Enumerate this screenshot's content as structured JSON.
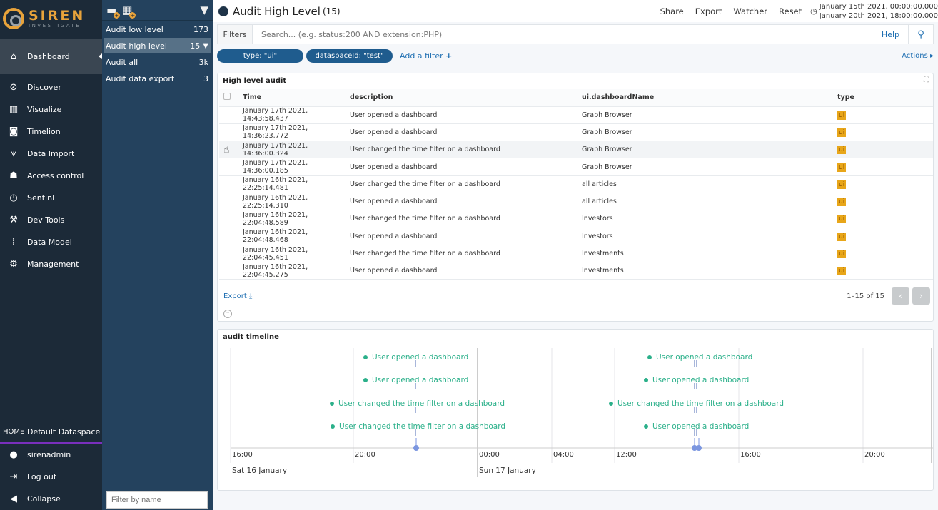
{
  "nav": {
    "logo_title": "SIREN",
    "logo_sub": "INVESTIGATE",
    "items": [
      {
        "label": "Dashboard",
        "icon": "home-icon",
        "active": true
      },
      {
        "label": "Discover",
        "icon": "compass-icon"
      },
      {
        "label": "Visualize",
        "icon": "bar-chart-icon"
      },
      {
        "label": "Timelion",
        "icon": "timelion-icon"
      },
      {
        "label": "Data Import",
        "icon": "data-import-icon"
      },
      {
        "label": "Access control",
        "icon": "users-icon"
      },
      {
        "label": "Sentinl",
        "icon": "alarm-icon"
      },
      {
        "label": "Dev Tools",
        "icon": "wrench-icon"
      },
      {
        "label": "Data Model",
        "icon": "data-model-icon"
      },
      {
        "label": "Management",
        "icon": "gear-icon"
      }
    ],
    "home_label": "HOME",
    "dataspace": "Default Dataspace",
    "user": "sirenadmin",
    "logout": "Log out",
    "collapse": "Collapse"
  },
  "dashboards": {
    "items": [
      {
        "label": "Audit low level",
        "count": "173"
      },
      {
        "label": "Audit high level",
        "count": "15",
        "selected": true
      },
      {
        "label": "Audit all",
        "count": "3k"
      },
      {
        "label": "Audit data export",
        "count": "3"
      }
    ],
    "filter_placeholder": "Filter by name"
  },
  "header": {
    "title": "Audit High Level",
    "count": "(15)",
    "menu": [
      "Share",
      "Export",
      "Watcher",
      "Reset"
    ],
    "time_from": "January 15th 2021, 00:00:00.000",
    "time_to": "January 20th 2021, 18:00:00.000"
  },
  "search": {
    "filters_label": "Filters",
    "placeholder": "Search... (e.g. status:200 AND extension:PHP)",
    "help": "Help"
  },
  "filters": {
    "pills": [
      "type: \"ui\"",
      "dataspaceId: \"test\""
    ],
    "add_filter": "Add a filter",
    "actions": "Actions"
  },
  "table_panel": {
    "title": "High level audit",
    "columns": [
      "Time",
      "description",
      "ui.dashboardName",
      "type"
    ],
    "rows": [
      {
        "time": "January 17th 2021, 14:43:58.437",
        "description": "User opened a dashboard",
        "dashboard": "Graph Browser",
        "type": "ui"
      },
      {
        "time": "January 17th 2021, 14:36:23.772",
        "description": "User opened a dashboard",
        "dashboard": "Graph Browser",
        "type": "ui"
      },
      {
        "time": "January 17th 2021, 14:36:00.324",
        "description": "User changed the time filter on a dashboard",
        "dashboard": "Graph Browser",
        "type": "ui"
      },
      {
        "time": "January 17th 2021, 14:36:00.185",
        "description": "User opened a dashboard",
        "dashboard": "Graph Browser",
        "type": "ui"
      },
      {
        "time": "January 16th 2021, 22:25:14.481",
        "description": "User changed the time filter on a dashboard",
        "dashboard": "all articles",
        "type": "ui"
      },
      {
        "time": "January 16th 2021, 22:25:14.310",
        "description": "User opened a dashboard",
        "dashboard": "all articles",
        "type": "ui"
      },
      {
        "time": "January 16th 2021, 22:04:48.589",
        "description": "User changed the time filter on a dashboard",
        "dashboard": "Investors",
        "type": "ui"
      },
      {
        "time": "January 16th 2021, 22:04:48.468",
        "description": "User opened a dashboard",
        "dashboard": "Investors",
        "type": "ui"
      },
      {
        "time": "January 16th 2021, 22:04:45.451",
        "description": "User changed the time filter on a dashboard",
        "dashboard": "Investments",
        "type": "ui"
      },
      {
        "time": "January 16th 2021, 22:04:45.275",
        "description": "User opened a dashboard",
        "dashboard": "Investments",
        "type": "ui"
      }
    ],
    "export": "Export",
    "pagination": "1–15 of 15"
  },
  "timeline_panel": {
    "title": "audit timeline",
    "left_events": [
      "User opened a dashboard",
      "User opened a dashboard",
      "User changed the time filter on a dashboard",
      "User changed the time filter on a dashboard"
    ],
    "right_events": [
      "User opened a dashboard",
      "User opened a dashboard",
      "User changed the time filter on a dashboard",
      "User opened a dashboard"
    ],
    "ticks": [
      "16:00",
      "20:00",
      "00:00",
      "04:00",
      "12:00",
      "16:00",
      "20:00"
    ],
    "days": [
      "Sat 16 January",
      "Sun 17 January"
    ]
  }
}
